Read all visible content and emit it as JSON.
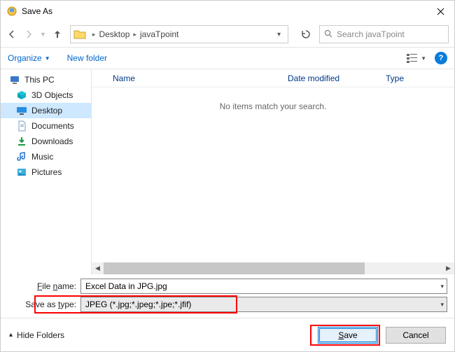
{
  "window": {
    "title": "Save As"
  },
  "path": {
    "crumbs": [
      "Desktop",
      "javaTpoint"
    ]
  },
  "search": {
    "placeholder": "Search javaTpoint"
  },
  "toolbar": {
    "organize": "Organize",
    "newfolder": "New folder"
  },
  "sidebar": {
    "items": [
      {
        "label": "This PC"
      },
      {
        "label": "3D Objects"
      },
      {
        "label": "Desktop"
      },
      {
        "label": "Documents"
      },
      {
        "label": "Downloads"
      },
      {
        "label": "Music"
      },
      {
        "label": "Pictures"
      }
    ]
  },
  "columns": {
    "name": "Name",
    "date": "Date modified",
    "type": "Type"
  },
  "empty": "No items match your search.",
  "form": {
    "filename_label": "File name:",
    "filename_value": "Excel Data in JPG.jpg",
    "type_label": "Save as type:",
    "type_value": "JPEG (*.jpg;*.jpeg;*.jpe;*.jfif)"
  },
  "footer": {
    "hide": "Hide Folders",
    "save": "Save",
    "cancel": "Cancel"
  }
}
